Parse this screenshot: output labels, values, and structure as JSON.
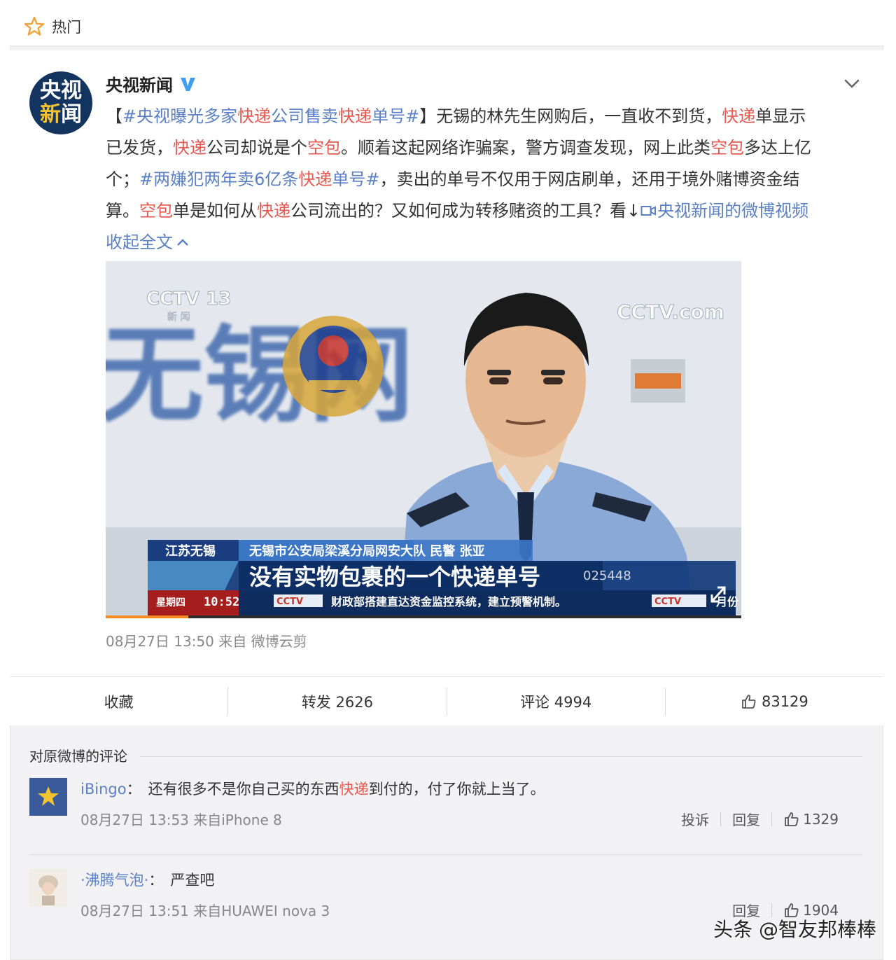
{
  "hot": {
    "label": "热门"
  },
  "post": {
    "author": "央视新闻",
    "avatar_line1": "央视",
    "avatar_line2a": "新",
    "avatar_line2b": "闻",
    "text": {
      "l1_a": "【",
      "l1_topic_a": "#央视曝光多家",
      "l1_topic_kw": "快递",
      "l1_topic_b": "公司售卖",
      "l1_topic_kw2": "快递",
      "l1_topic_c": "单号#",
      "l1_b": "】无锡的林先生网购后，一直收不到货，",
      "l1_kw": "快递",
      "l1_c": "单显示",
      "l2_a": "已发货，",
      "l2_kw": "快递",
      "l2_b": "公司却说是个",
      "l2_kw2": "空包",
      "l2_c": "。顺着这起网络诈骗案，警方调查发现，网上此类",
      "l2_kw3": "空包",
      "l2_d": "多达上亿",
      "l3_a": "个；",
      "l3_topic_a": "#两嫌犯两年卖6亿条",
      "l3_topic_kw": "快递",
      "l3_topic_b": "单号#",
      "l3_b": "，卖出的单号不仅用于网店刷单，还用于境外赌博资金结",
      "l4_a": "算。",
      "l4_kw": "空包",
      "l4_b": "单是如何从",
      "l4_kw2": "快递",
      "l4_c": "公司流出的？又如何成为转移赌资的工具？看↓",
      "l4_link": "央视新闻的微博视频",
      "collapse": "收起全文"
    },
    "video": {
      "channel_logo": "CCTV 13",
      "channel_sub": "新  闻",
      "corner_logo": "CCTV.com",
      "wall_text": "无锡网",
      "location": "江苏无锡",
      "speaker": "无锡市公安局梁溪分局网安大队 民警 张亚",
      "caption": "没有实物包裹的一个快递单号",
      "badge": "025448",
      "weekday": "星期四",
      "clock": "10:52",
      "ticker": "财政部搭建直达资金监控系统，建立预警机制。",
      "ticker_tail": "月份",
      "progress": 0.13
    },
    "meta": "08月27日 13:50  来自 微博云剪"
  },
  "actions": {
    "collect": "收藏",
    "repost": "转发 2626",
    "comment": "评论 4994",
    "like": "83129"
  },
  "comments": {
    "header": "对原微博的评论",
    "items": [
      {
        "user": "iBingo",
        "colon": "：",
        "text_a": "还有很多不是你自己买的东西",
        "kw": "快递",
        "text_b": "到付的，付了你就上当了。",
        "time": "08月27日 13:53 来自iPhone 8",
        "report": "投诉",
        "reply": "回复",
        "likes": "1329"
      },
      {
        "user": "·沸腾气泡·",
        "colon": "：",
        "text_a": "严查吧",
        "time": "08月27日 13:51 来自HUAWEI nova 3",
        "reply": "回复",
        "likes": "1904"
      }
    ]
  },
  "watermark": "头条 @智友邦棒棒",
  "colors": {
    "link": "#5b80c6",
    "keyword": "#e8584f",
    "progress": "#f58a1f"
  }
}
